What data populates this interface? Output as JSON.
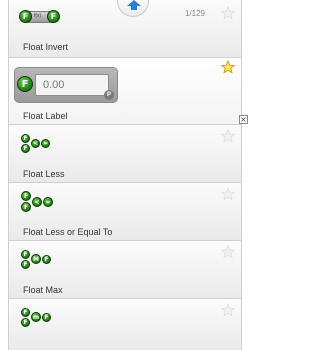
{
  "counter": "1/129",
  "rows": [
    {
      "label": "Float Invert"
    },
    {
      "label": "Float Label",
      "field_value": "0.00"
    },
    {
      "label": "Float Less"
    },
    {
      "label": "Float Less or Equal To"
    },
    {
      "label": "Float Max"
    },
    {
      "label": ""
    }
  ],
  "icons": {
    "node_letter": "F",
    "invert_mid": "f(x)",
    "less_ops": [
      "<",
      "="
    ],
    "less_eq_ops": [
      "<",
      "="
    ],
    "max_mid": "M",
    "min_mid": "m",
    "badge": "P",
    "close": "×"
  },
  "colors": {
    "node_green": "#1f7a12",
    "star_active": "#f2c230",
    "star_inactive": "#e0e0e0"
  }
}
